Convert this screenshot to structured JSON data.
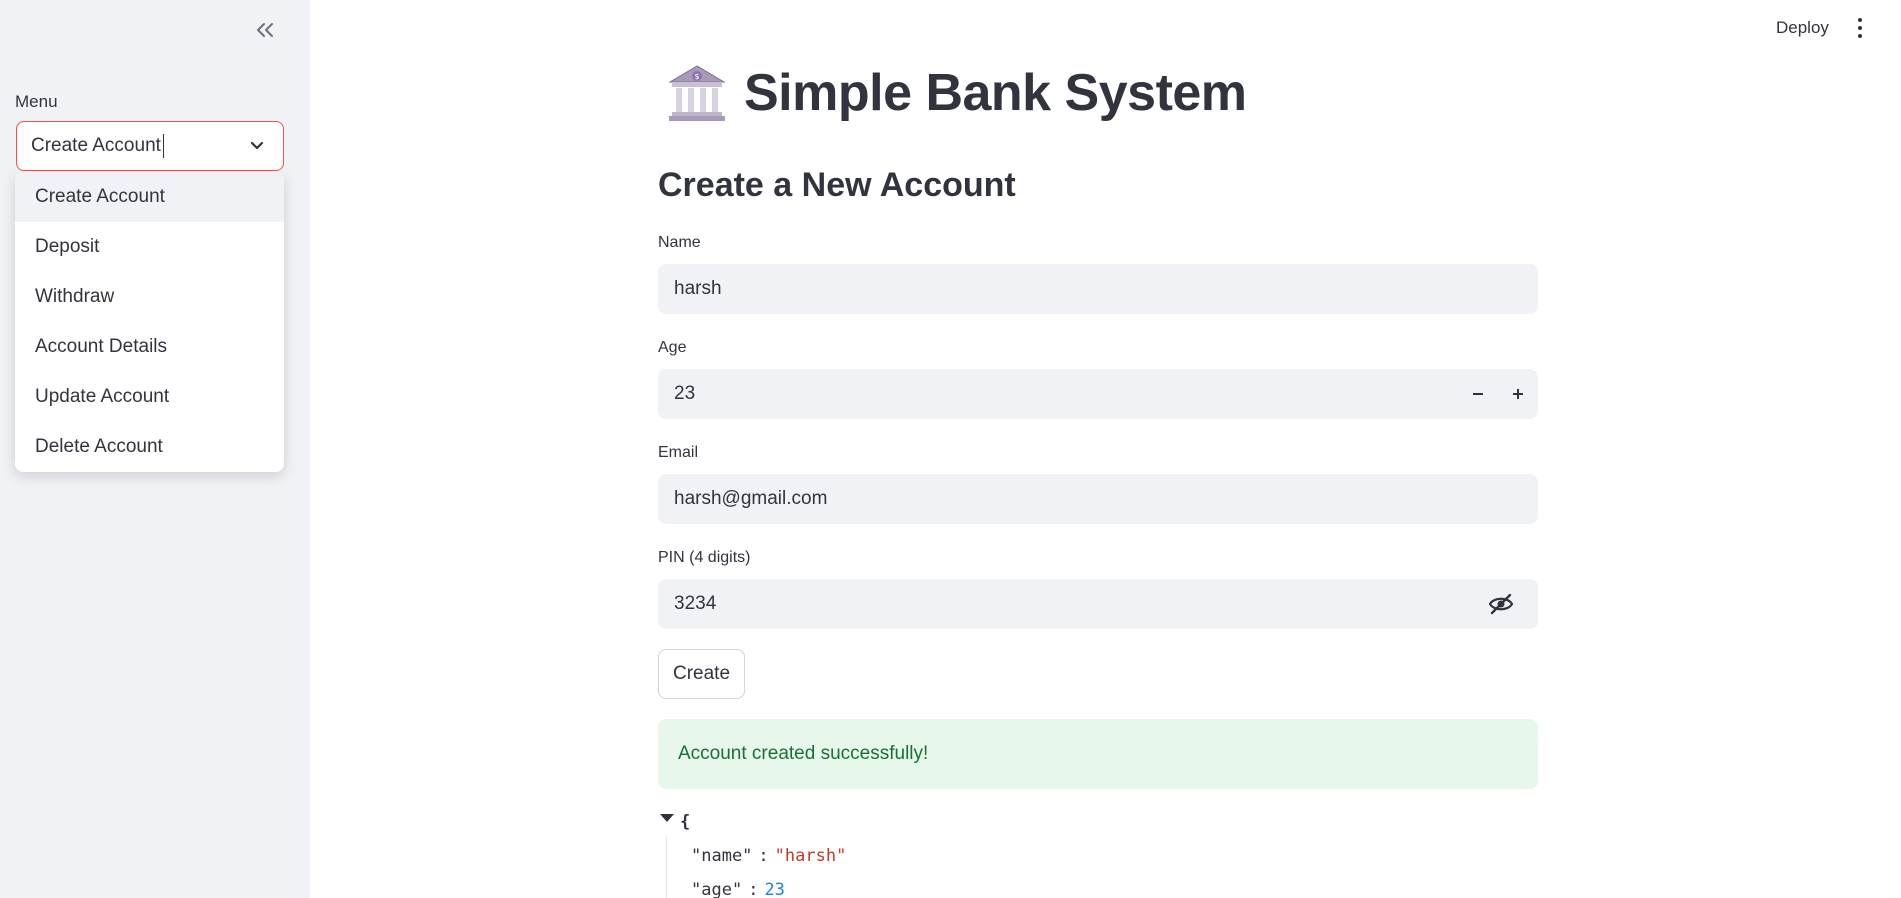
{
  "sidebar": {
    "menu_label": "Menu",
    "selected": "Create Account",
    "options": [
      "Create Account",
      "Deposit",
      "Withdraw",
      "Account Details",
      "Update Account",
      "Delete Account"
    ]
  },
  "header": {
    "deploy_label": "Deploy"
  },
  "main": {
    "title": "Simple Bank System",
    "subtitle": "Create a New Account",
    "fields": {
      "name": {
        "label": "Name",
        "value": "harsh"
      },
      "age": {
        "label": "Age",
        "value": "23"
      },
      "email": {
        "label": "Email",
        "value": "harsh@gmail.com"
      },
      "pin": {
        "label": "PIN (4 digits)",
        "value": "3234"
      }
    },
    "create_label": "Create",
    "success_message": "Account created successfully!",
    "json": {
      "open_brace": "{",
      "rows": [
        {
          "key": "\"name\"",
          "value": "\"harsh\"",
          "type": "string"
        },
        {
          "key": "\"age\"",
          "value": "23",
          "type": "number"
        }
      ]
    }
  },
  "colors": {
    "accent": "#ff4b4b",
    "sidebar_bg": "#f0f2f6",
    "success_bg": "#e8f7ec",
    "success_text": "#177233"
  }
}
